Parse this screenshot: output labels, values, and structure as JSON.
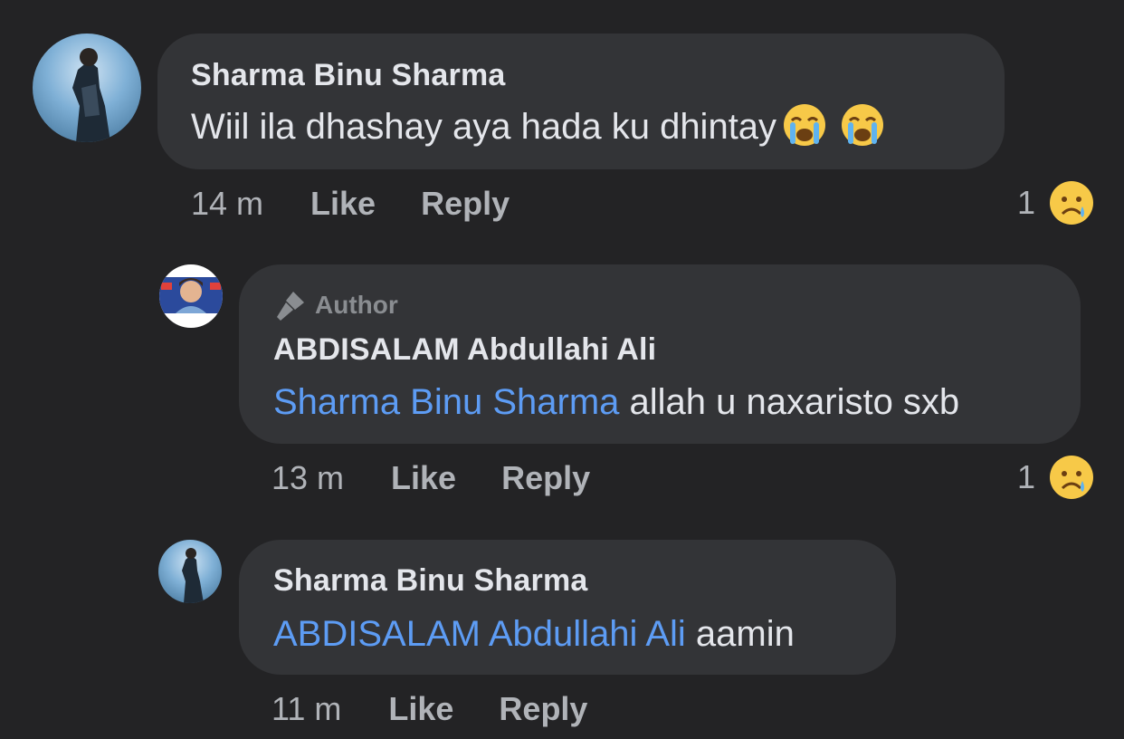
{
  "comments": [
    {
      "author": "Sharma Binu Sharma",
      "text": "Wiil ila dhashay aya hada ku dhintay",
      "emoji_after_text": [
        "loudly-crying-face-icon",
        "loudly-crying-face-icon"
      ],
      "time": "14 m",
      "like_label": "Like",
      "reply_label": "Reply",
      "reaction_count": "1",
      "reaction_icon": "sad-tear-face-icon"
    },
    {
      "author_tag": "Author",
      "author": "ABDISALAM Abdullahi Ali",
      "mention": "Sharma Binu Sharma",
      "text": " allah u naxaristo sxb",
      "time": "13 m",
      "like_label": "Like",
      "reply_label": "Reply",
      "reaction_count": "1",
      "reaction_icon": "sad-tear-face-icon"
    },
    {
      "author": "Sharma Binu Sharma",
      "mention": "ABDISALAM Abdullahi Ali",
      "text": " aamin",
      "time": "11 m",
      "like_label": "Like",
      "reply_label": "Reply"
    }
  ],
  "colors": {
    "background": "#232325",
    "bubble": "#333437",
    "mention": "#5d9cf4",
    "secondary_text": "#b0b3b8"
  }
}
